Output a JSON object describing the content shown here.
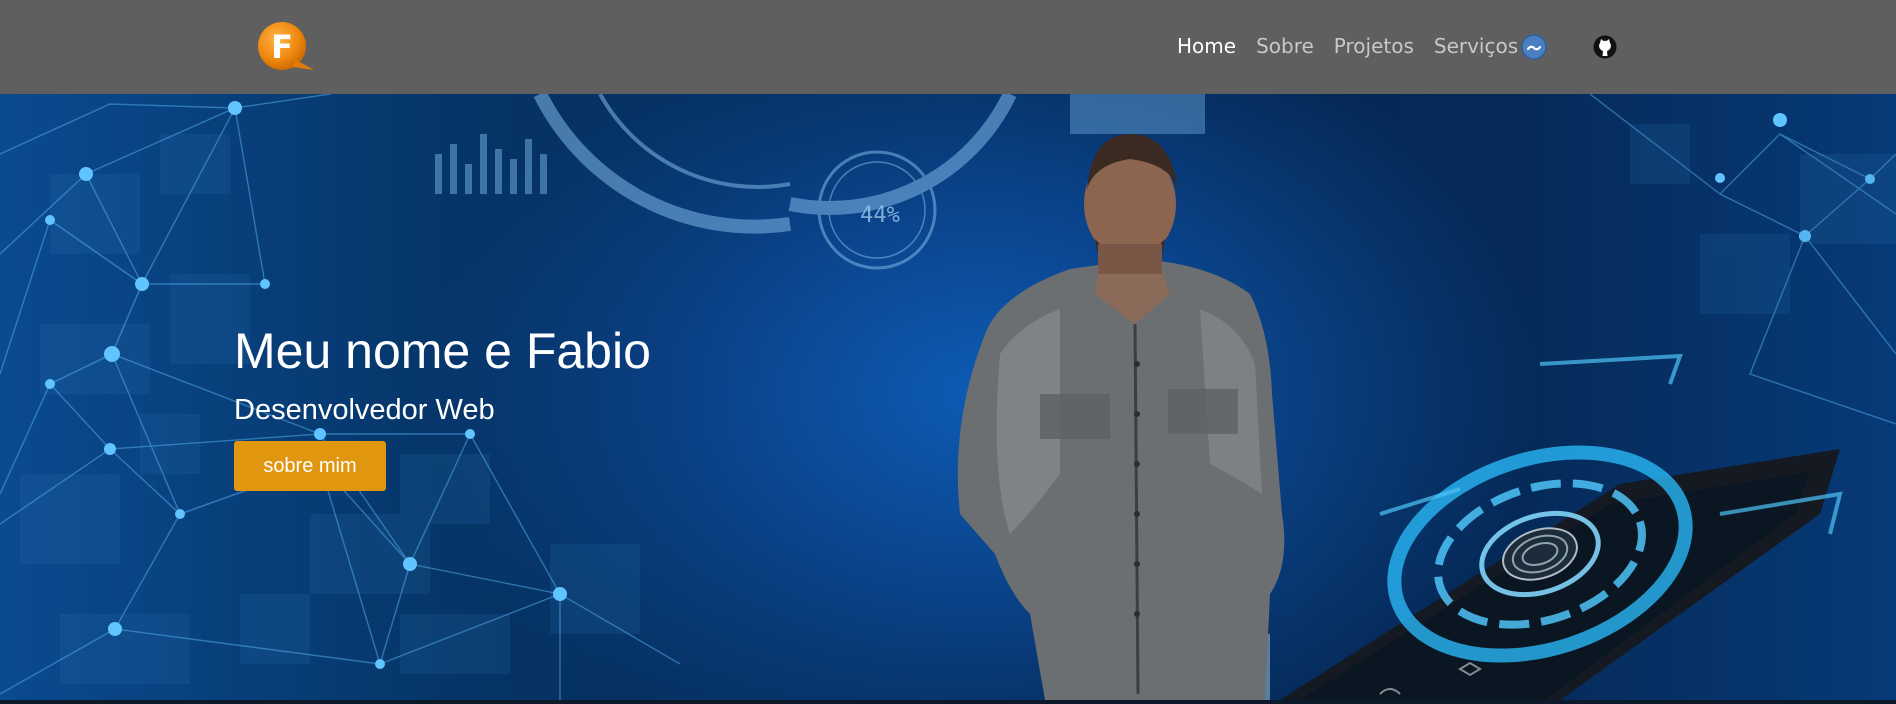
{
  "navbar": {
    "logo_letter": "F",
    "links": [
      {
        "label": "Home",
        "active": true
      },
      {
        "label": "Sobre",
        "active": false
      },
      {
        "label": "Projetos",
        "active": false
      },
      {
        "label": "Serviços",
        "active": false
      }
    ],
    "social": [
      "linkedin-icon",
      "github-icon"
    ]
  },
  "hero": {
    "title": "Meu nome e Fabio",
    "subtitle": "Desenvolvedor Web",
    "button_label": "sobre mim",
    "gauge_text": "44%"
  },
  "colors": {
    "navbar_bg": "#5f5f5f",
    "accent_button": "#e0960f",
    "logo_orange": "#f08a10",
    "hero_blue": "#063466"
  }
}
